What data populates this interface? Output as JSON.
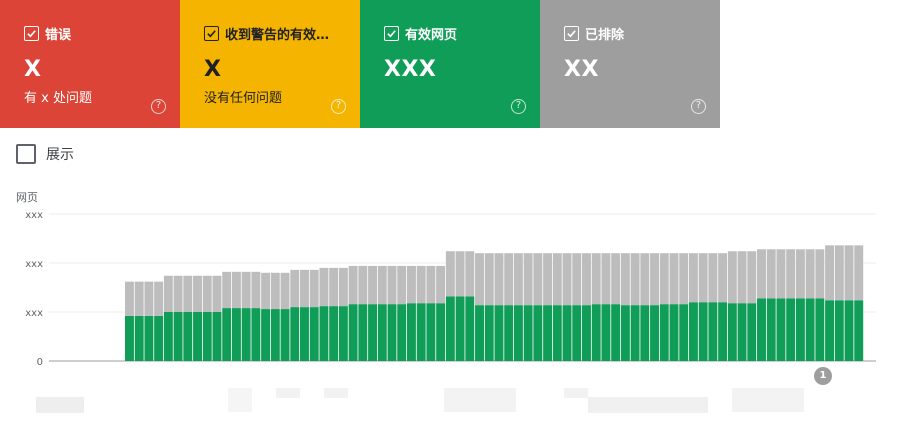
{
  "cards": [
    {
      "title": "错误",
      "value": "X",
      "subtitle": "有 x 处问题",
      "color": "#db4437",
      "checked": true
    },
    {
      "title": "收到警告的有效…",
      "value": "X",
      "subtitle": "没有任何问题",
      "color": "#f4b400",
      "checked": true
    },
    {
      "title": "有效网页",
      "value": "XXX",
      "subtitle": "",
      "color": "#0f9d58",
      "checked": true
    },
    {
      "title": "已排除",
      "value": "XX",
      "subtitle": "",
      "color": "#9e9e9e",
      "checked": true
    }
  ],
  "impressions_toggle": {
    "label": "展示",
    "checked": false
  },
  "chart_data": {
    "type": "bar",
    "stacked": true,
    "ylabel": "网页",
    "y_tick_labels": [
      "0",
      "xxx",
      "xxx",
      "xxx"
    ],
    "ylim": [
      0,
      150
    ],
    "categories": [
      "1",
      "2",
      "3",
      "4",
      "5",
      "6",
      "7",
      "8",
      "9",
      "10",
      "11",
      "12",
      "13",
      "14",
      "15",
      "16",
      "17",
      "18",
      "19",
      "20",
      "21",
      "22",
      "23",
      "24",
      "25",
      "26",
      "27",
      "28",
      "29",
      "30",
      "31",
      "32",
      "33",
      "34",
      "35",
      "36",
      "37",
      "38",
      "39",
      "40",
      "41",
      "42",
      "43",
      "44",
      "45",
      "46",
      "47",
      "48",
      "49",
      "50",
      "51",
      "52",
      "53",
      "54",
      "55",
      "56",
      "57",
      "58",
      "59",
      "60",
      "61",
      "62",
      "63",
      "64",
      "65",
      "66",
      "67",
      "68",
      "69",
      "70",
      "71",
      "72",
      "73",
      "74",
      "75",
      "76",
      "77",
      "78",
      "79",
      "80",
      "81",
      "82",
      "83",
      "84",
      "85",
      "86",
      "87",
      "88",
      "89",
      "90"
    ],
    "series": [
      {
        "color": "#0f9d58",
        "values": [
          0,
          0,
          0,
          0,
          0,
          0,
          0,
          0,
          0,
          0,
          0,
          0,
          0,
          0,
          0,
          0,
          0,
          0,
          0,
          0,
          0,
          0,
          0,
          0,
          0,
          0,
          0,
          0,
          0,
          0,
          0,
          0,
          0,
          0,
          0,
          0,
          0,
          0,
          0,
          0,
          0,
          0,
          0,
          0,
          0,
          0,
          0,
          0,
          0,
          0,
          0,
          0,
          0,
          0,
          0,
          0,
          0,
          0,
          0,
          0,
          0,
          0,
          0,
          0,
          0,
          0,
          0,
          0,
          0,
          0,
          0,
          0,
          0,
          0,
          0,
          0,
          0,
          0,
          0,
          0,
          0,
          0,
          0,
          0,
          0,
          0,
          0,
          0,
          0,
          0
        ]
      },
      {
        "color": "#0f9d58",
        "values": [
          46,
          46,
          46,
          46,
          50,
          50,
          50,
          50,
          50,
          50,
          54,
          54,
          54,
          54,
          53,
          53,
          53,
          55,
          55,
          55,
          56,
          56,
          56,
          58,
          58,
          58,
          58,
          58,
          58,
          59,
          59,
          59,
          59,
          66,
          66,
          66,
          57,
          57,
          57,
          57,
          57,
          57,
          57,
          57,
          57,
          57,
          57,
          57,
          58,
          58,
          58,
          57,
          57,
          57,
          57,
          58,
          58,
          58,
          60,
          60,
          60,
          60,
          59,
          59,
          59,
          64,
          64,
          64,
          64,
          64,
          64,
          64,
          62,
          62,
          62,
          62
        ]
      },
      {
        "color": "#bdbdbd",
        "values": [
          35,
          35,
          35,
          35,
          37,
          37,
          37,
          37,
          37,
          37,
          37,
          37,
          37,
          37,
          37,
          37,
          37,
          38,
          38,
          38,
          39,
          39,
          39,
          39,
          39,
          39,
          39,
          39,
          39,
          38,
          38,
          38,
          38,
          46,
          46,
          46,
          53,
          53,
          53,
          53,
          53,
          53,
          53,
          53,
          53,
          53,
          53,
          53,
          52,
          52,
          52,
          53,
          53,
          53,
          53,
          52,
          52,
          52,
          50,
          50,
          50,
          50,
          53,
          53,
          53,
          50,
          50,
          50,
          50,
          50,
          50,
          50,
          56,
          56,
          56,
          56
        ]
      }
    ],
    "annotations": [
      "1"
    ]
  }
}
